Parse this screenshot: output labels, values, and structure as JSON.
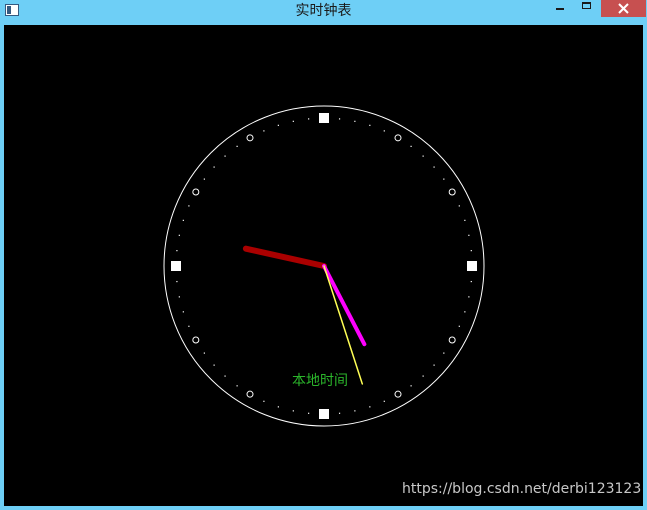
{
  "window": {
    "title": "实时钟表",
    "colors": {
      "frame": "#6ecff6",
      "close": "#c75050",
      "background": "#000000"
    }
  },
  "controls": {
    "minimize_icon": "minimize-icon",
    "maximize_icon": "maximize-icon",
    "close_icon": "close-icon"
  },
  "clock": {
    "label": "本地时间",
    "time": {
      "hour": 9,
      "minute": 25,
      "second": 27
    },
    "colors": {
      "face": "#ffffff",
      "hour_hand": "#aa0000",
      "minute_hand": "#ff00ff",
      "second_hand": "#ffff55",
      "label": "#2bb52b"
    }
  },
  "watermark": "https://blog.csdn.net/derbi123123"
}
